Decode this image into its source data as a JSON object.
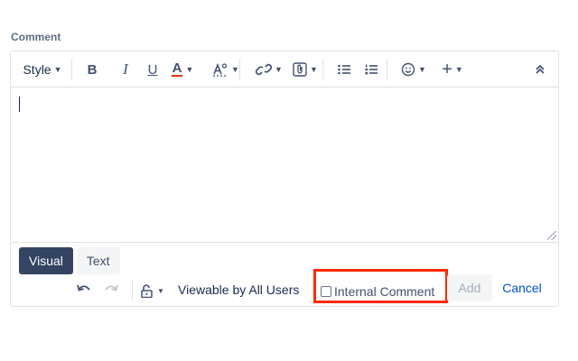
{
  "comment_label": "Comment",
  "toolbar": {
    "style_label": "Style",
    "bold_glyph": "B",
    "italic_glyph": "I",
    "underline_glyph": "U",
    "text_color_glyph": "A",
    "text_color_accent": "#de350b",
    "text_effects_glyph": "A°",
    "chevron": "⌄",
    "emoji_glyph": "☺",
    "plus_glyph": "+",
    "collapse_glyph": "⌃"
  },
  "editor": {
    "content": ""
  },
  "mode_tabs": {
    "visual": "Visual",
    "text": "Text"
  },
  "footer": {
    "undo_glyph": "↶",
    "redo_glyph": "↷",
    "visibility": "Viewable by All Users",
    "internal_comment_label": "Internal Comment",
    "add_label": "Add",
    "cancel_label": "Cancel"
  },
  "colors": {
    "highlight": "#ff2a00",
    "active_tab": "#344563",
    "link": "#0052cc"
  }
}
